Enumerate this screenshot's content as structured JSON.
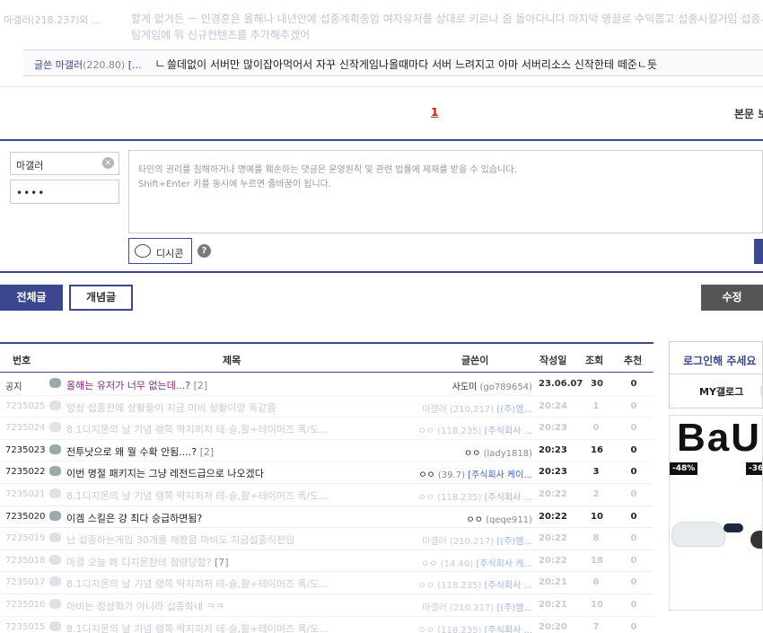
{
  "top_comment": {
    "author": "마갤러(218.237)외 ...",
    "text_line1": "할게 없거든 ㅡ 인경훈은 올해나 내년안에 섭종계획중임 여자유저를 상대로 키르나 줌 돌아다니다 마지막 영끌로 수익뽑고 섭종시킬거임 섭종시",
    "text_line2": "팀게임에 뭐 신규컨텐츠를 추가해주겠어"
  },
  "reply_comment": {
    "author": "글쓴 마갤러",
    "ip": "(220.80)",
    "ellipsis": "[...",
    "arrow": "ㄴ",
    "text": "쓸데없이 서버만 많이잡아먹어서 자꾸 신작게임나올때마다 서버 느려지고 아마 서버리소스 신작한테 떼준ㄴ듯"
  },
  "pagination": {
    "current": "1"
  },
  "bonmun_label": "본문 보",
  "write": {
    "nickname_value": "마갤러",
    "password_value": "••••",
    "notice_line1": "타인의 권리를 침해하거나 명예를 훼손하는 댓글은 운영원칙 및 관련 법률에 제재를 받을 수 있습니다.",
    "notice_line2": "Shift+Enter 키를 동시에 누르면 줄바꿈이 됩니다.",
    "dccon_label": "디시콘",
    "help": "?"
  },
  "tabs": {
    "all": "전체글",
    "concept": "개념글",
    "edit": "수정"
  },
  "table": {
    "headers": {
      "num": "번호",
      "title": "제목",
      "author": "글쓴이",
      "date": "작성일",
      "views": "조회",
      "rec": "추천"
    },
    "rows": [
      {
        "num": "공지",
        "title": "올해는 유저가 너무 없는데...?",
        "cnt": "[2]",
        "author": "사도미",
        "ip": "(go789654)",
        "comp": "",
        "date": "23.06.07",
        "views": "30",
        "rec": "0",
        "style": "notice"
      },
      {
        "num": "7235025",
        "title": "양상 섭종전에 상황들이 지금 머비 상황이랑 똑같음",
        "cnt": "",
        "author": "마갤러",
        "ip": "(210.217)",
        "comp": "[(주)엠...",
        "date": "20:24",
        "views": "1",
        "rec": "0",
        "style": "faded"
      },
      {
        "num": "7235024",
        "title": "8.1디지몬의 날 기념 랭쪽 딱지퍼저 테-슬,활+테이머즈 폭/도...",
        "cnt": "",
        "author": "ㅇㅇ",
        "ip": "(118.235)",
        "comp": "[주식회사 ...",
        "date": "20:23",
        "views": "0",
        "rec": "0",
        "style": "faded"
      },
      {
        "num": "7235023",
        "title": "전투낫으로 왜 뭘 수확 안됨....?",
        "cnt": "[2]",
        "author": "ㅇㅇ",
        "ip": "(lady1818)",
        "comp": "",
        "date": "20:23",
        "views": "16",
        "rec": "0",
        "style": "normal"
      },
      {
        "num": "7235022",
        "title": "이번 명절 패키지는 그냥 레전드급으로 나오겠다",
        "cnt": "",
        "author": "ㅇㅇ",
        "ip": "(39.7)",
        "comp": "[주식회사 케이...",
        "date": "20:23",
        "views": "3",
        "rec": "0",
        "style": "normal"
      },
      {
        "num": "7235021",
        "title": "8.1디지몬의 날 기념 랭쪽 딱지퍼저 테-슬,활+테이머즈 폭/도...",
        "cnt": "",
        "author": "ㅇㅇ",
        "ip": "(118.235)",
        "comp": "[주식회사 ...",
        "date": "20:22",
        "views": "2",
        "rec": "0",
        "style": "faded"
      },
      {
        "num": "7235020",
        "title": "이겜 스킬은 걍 최다 승급하면됨?",
        "cnt": "",
        "author": "ㅇㅇ",
        "ip": "(qeqe911)",
        "comp": "",
        "date": "20:22",
        "views": "10",
        "rec": "0",
        "style": "normal"
      },
      {
        "num": "7235019",
        "title": "난 섭종하는게임 30개를 해봤음 마비도 지금섭종직전임",
        "cnt": "",
        "author": "마갤러",
        "ip": "(210.217)",
        "comp": "[(주)엠...",
        "date": "20:22",
        "views": "8",
        "rec": "0",
        "style": "faded"
      },
      {
        "num": "7235018",
        "title": "마결 오늘 왜 디지몬한테 점령당함?",
        "cnt": "[7]",
        "author": "ㅇㅇ",
        "ip": "(14.40)",
        "comp": "[주식회사 케...",
        "date": "20:22",
        "views": "18",
        "rec": "0",
        "style": "faded"
      },
      {
        "num": "7235017",
        "title": "8.1디지몬의 날 기념 랭쪽 딱지퍼저 테-슬,활+테이머즈 폭/도...",
        "cnt": "",
        "author": "ㅇㅇ",
        "ip": "(118.235)",
        "comp": "[주식회사 ...",
        "date": "20:21",
        "views": "6",
        "rec": "0",
        "style": "faded"
      },
      {
        "num": "7235016",
        "title": "마비는 정상화가 아니라 섭종화네 ㅋㅋ",
        "cnt": "",
        "author": "마갤러",
        "ip": "(210.217)",
        "comp": "[(주)엠...",
        "date": "20:21",
        "views": "10",
        "rec": "0",
        "style": "faded"
      },
      {
        "num": "7235015",
        "title": "8.1디지몬의 날 기념 랭쪽 딱지퍼저 테-슬,활+테이머즈 폭/도...",
        "cnt": "",
        "author": "ㅇㅇ",
        "ip": "(118.235)",
        "comp": "[주식회사 ...",
        "date": "20:20",
        "views": "7",
        "rec": "0",
        "style": "faded"
      }
    ]
  },
  "right_panel": {
    "login_title": "로그인해 주세요",
    "my_gallog": "MY갤로그",
    "sep": "|",
    "ad_logo": "BaU",
    "disc1": "-48%",
    "disc2": "-36"
  },
  "colors": {
    "navy": "#3b4890",
    "notice_purple": "#84297c",
    "page_red": "#d31900"
  }
}
